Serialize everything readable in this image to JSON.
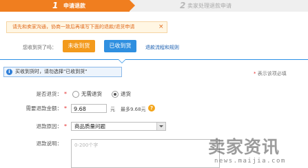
{
  "steps": {
    "step1": {
      "number": "1",
      "label": "申请退款"
    },
    "step2": {
      "number": "2",
      "label": "卖家处理退款申请"
    }
  },
  "notice": {
    "text": "请先和卖家沟通，协商一致后再填写下面的退款/退货申请",
    "close": "×"
  },
  "receipt_question": {
    "label": "您收到货了吗：",
    "not_received_label": "未收到货",
    "received_label": "已收到货",
    "flow_link": "退款流程和规则"
  },
  "info": {
    "icon": "i",
    "text": "买收到货时，请勿选择\"已收到货\""
  },
  "required_note": {
    "star": "*",
    "text": " 表示该项必填"
  },
  "form": {
    "return_goods": {
      "label": "是否退货：",
      "star": "*",
      "options": [
        "无需退货",
        "退货"
      ],
      "selected": "退货"
    },
    "refund_amount": {
      "label": "需要退款金额：",
      "star": "*",
      "value": "9.68",
      "unit": "元",
      "max_text": "最多9.68元",
      "help_icon": "?"
    },
    "refund_reason": {
      "label": "退款原因：",
      "star": "*",
      "selected": "商品质量问题"
    },
    "refund_desc": {
      "label": "退款说明：",
      "placeholder": "0-200个字"
    }
  },
  "watermark": {
    "title": "卖家资讯",
    "url": "news.maijia.com"
  },
  "colors": {
    "orange": "#f07e1f",
    "blue": "#2f8fe0",
    "required": "#e52b2b"
  }
}
